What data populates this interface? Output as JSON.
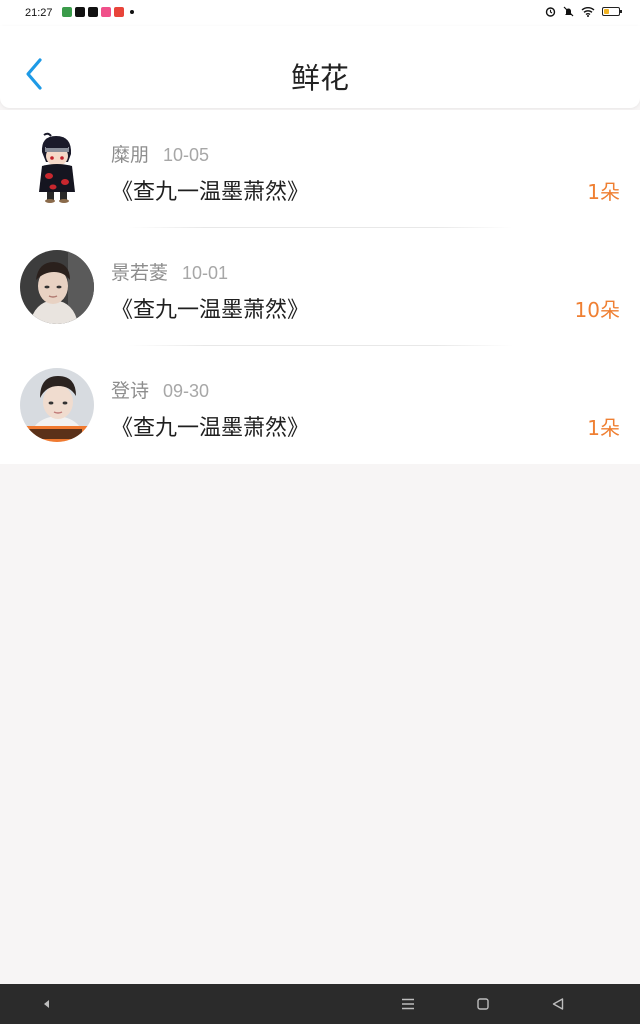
{
  "status_bar": {
    "time": "21:27",
    "battery_level": 0.4,
    "colors": {
      "battery": "#f1b322"
    }
  },
  "header": {
    "title": "鲜花"
  },
  "colors": {
    "accent_back": "#1e9ae6",
    "count_orange": "#ef7f32",
    "meta_gray": "#8d8d8d"
  },
  "gifts": [
    {
      "name": "糜朋",
      "date": "10-05",
      "title": "《查九一温墨萧然》",
      "count": "1朵",
      "avatar": "ninja-avatar"
    },
    {
      "name": "景若菱",
      "date": "10-01",
      "title": "《查九一温墨萧然》",
      "count": "10朵",
      "avatar": "person-avatar"
    },
    {
      "name": "登诗",
      "date": "09-30",
      "title": "《查九一温墨萧然》",
      "count": "1朵",
      "avatar": "person-avatar"
    }
  ],
  "nav": {
    "icons": [
      "back-triangle-icon",
      "menu-icon",
      "home-square-icon",
      "back-icon"
    ]
  }
}
